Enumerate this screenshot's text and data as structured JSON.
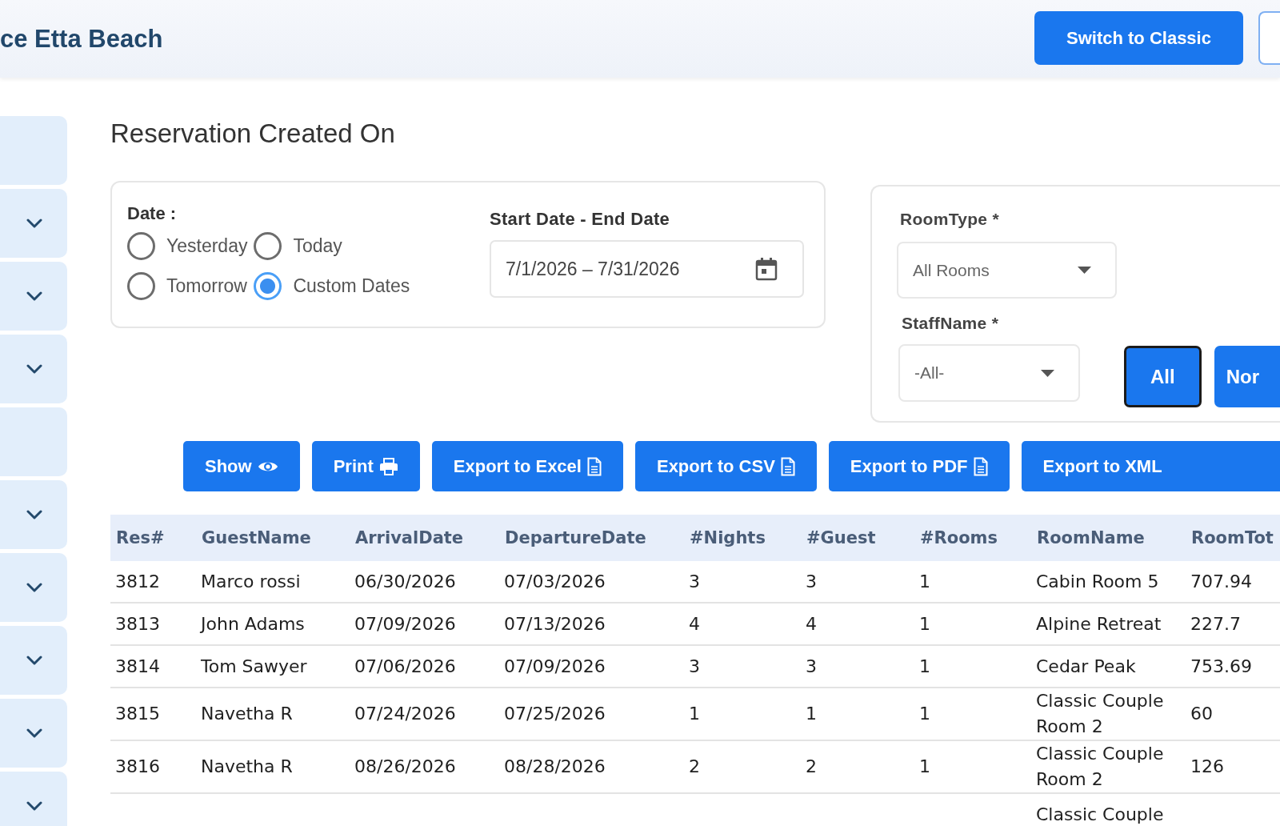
{
  "header": {
    "title": "ce Etta Beach",
    "buttons": [
      {
        "kind": "filled",
        "label": "Switch to Classic"
      },
      {
        "kind": "outline"
      }
    ]
  },
  "sidebar": {
    "items": [
      {
        "kind": "link"
      },
      {
        "kind": "menu"
      },
      {
        "kind": "menu"
      },
      {
        "kind": "menu"
      },
      {
        "kind": "link"
      },
      {
        "kind": "menu"
      },
      {
        "kind": "menu"
      },
      {
        "kind": "menu"
      },
      {
        "kind": "menu"
      },
      {
        "kind": "menu"
      }
    ]
  },
  "page_title": "Reservation Created On",
  "date_filter": {
    "label": "Date :",
    "options": [
      {
        "label": "Yesterday",
        "selected": false
      },
      {
        "label": "Today",
        "selected": false
      },
      {
        "label": "Tomorrow",
        "selected": false
      },
      {
        "label": "Custom Dates",
        "selected": true
      }
    ],
    "range_label": "Start Date - End Date",
    "range_value": "7/1/2026 – 7/31/2026"
  },
  "room_filters": {
    "fields": [
      {
        "label": "RoomType *",
        "value": "All Rooms"
      },
      {
        "label": "StaffName *",
        "value": "-All-"
      }
    ],
    "buttons": [
      {
        "label": "All",
        "selected": true
      },
      {
        "label": "Nor",
        "selected": false
      }
    ]
  },
  "actions": [
    {
      "kind": "view",
      "label": "Show"
    },
    {
      "kind": "print",
      "label": "Print"
    },
    {
      "kind": "export",
      "label": "Export to Excel"
    },
    {
      "kind": "export",
      "label": "Export to CSV"
    },
    {
      "kind": "export",
      "label": "Export to PDF"
    },
    {
      "kind": "plain",
      "label": "Export to XML"
    }
  ],
  "table": {
    "columns": [
      "Res#",
      "GuestName",
      "ArrivalDate",
      "DepartureDate",
      "#Nights",
      "#Guest",
      "#Rooms",
      "RoomName",
      "RoomTot"
    ],
    "rows": [
      {
        "res_no": "3812",
        "guest_name": "Marco rossi",
        "arrival_date": "06/30/2026",
        "departure_date": "07/03/2026",
        "nights": "3",
        "guests": "3",
        "rooms": "1",
        "room_name": "Cabin Room 5",
        "room_tot": "707.94"
      },
      {
        "res_no": "3813",
        "guest_name": "John Adams",
        "arrival_date": "07/09/2026",
        "departure_date": "07/13/2026",
        "nights": "4",
        "guests": "4",
        "rooms": "1",
        "room_name": "Alpine Retreat",
        "room_tot": "227.7"
      },
      {
        "res_no": "3814",
        "guest_name": "Tom Sawyer",
        "arrival_date": "07/06/2026",
        "departure_date": "07/09/2026",
        "nights": "3",
        "guests": "3",
        "rooms": "1",
        "room_name": "Cedar Peak",
        "room_tot": "753.69"
      },
      {
        "res_no": "3815",
        "guest_name": "Navetha R",
        "arrival_date": "07/24/2026",
        "departure_date": "07/25/2026",
        "nights": "1",
        "guests": "1",
        "rooms": "1",
        "room_name": "Classic Couple Room 2",
        "room_tot": "60"
      },
      {
        "res_no": "3816",
        "guest_name": "Navetha R",
        "arrival_date": "08/26/2026",
        "departure_date": "08/28/2026",
        "nights": "2",
        "guests": "2",
        "rooms": "1",
        "room_name": "Classic Couple Room 2",
        "room_tot": "126"
      },
      {
        "room_name": "Classic Couple"
      }
    ]
  }
}
